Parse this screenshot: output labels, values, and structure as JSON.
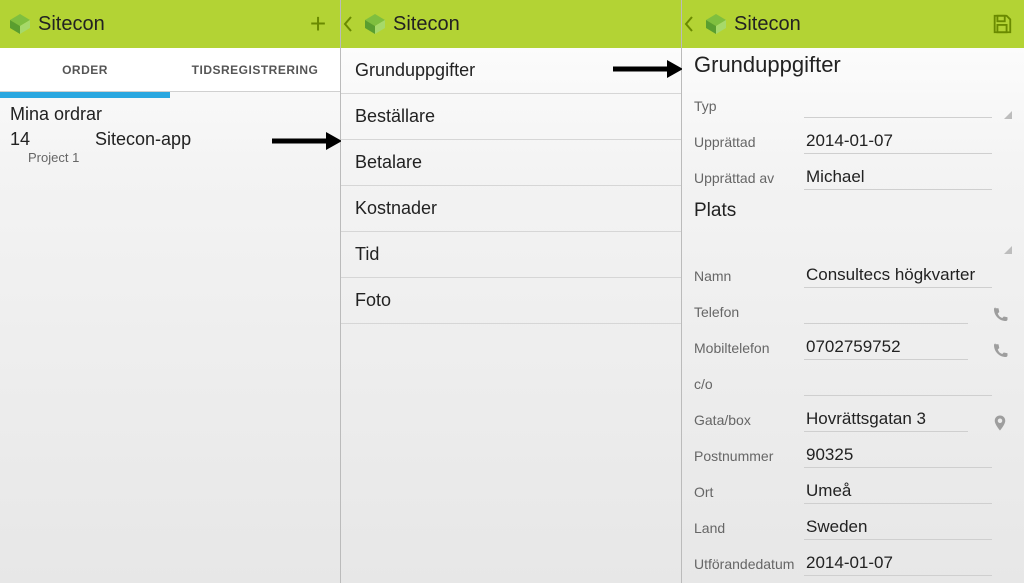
{
  "screen1": {
    "title": "Sitecon",
    "tabs": {
      "order": "ORDER",
      "tids": "TIDSREGISTRERING",
      "active": 0
    },
    "section_label": "Mina ordrar",
    "order": {
      "number": "14",
      "name": "Sitecon-app",
      "project": "Project 1"
    }
  },
  "screen2": {
    "title": "Sitecon",
    "items": [
      "Grunduppgifter",
      "Beställare",
      "Betalare",
      "Kostnader",
      "Tid",
      "Foto"
    ]
  },
  "screen3": {
    "title": "Sitecon",
    "form_title": "Grunduppgifter",
    "typ_label": "Typ",
    "upprattad_label": "Upprättad",
    "upprattad_value": "2014-01-07",
    "upprattad_av_label": "Upprättad av",
    "upprattad_av_value": "Michael",
    "plats_title": "Plats",
    "namn_label": "Namn",
    "namn_value": "Consultecs högkvarter",
    "telefon_label": "Telefon",
    "telefon_value": "",
    "mobil_label": "Mobiltelefon",
    "mobil_value": "0702759752",
    "co_label": "c/o",
    "co_value": "",
    "gata_label": "Gata/box",
    "gata_value": "Hovrättsgatan 3",
    "post_label": "Postnummer",
    "post_value": "90325",
    "ort_label": "Ort",
    "ort_value": "Umeå",
    "land_label": "Land",
    "land_value": "Sweden",
    "utforande_label": "Utförandedatum",
    "utforande_value": "2014-01-07"
  }
}
